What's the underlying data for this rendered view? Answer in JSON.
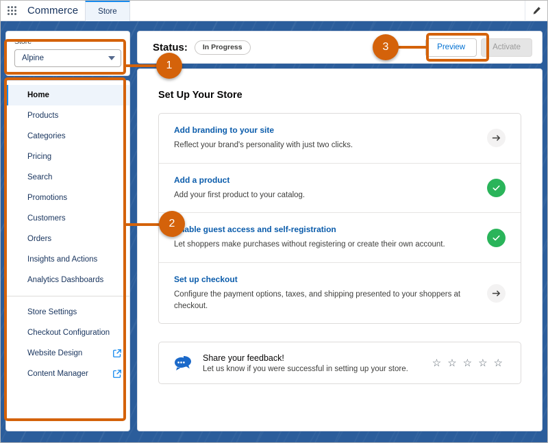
{
  "header": {
    "app_launcher_icon": "app-launcher-grid-icon",
    "app_name": "Commerce",
    "tab_label": "Store",
    "edit_icon": "pencil-icon"
  },
  "store_selector": {
    "label": "Store",
    "value": "Alpine",
    "caret_icon": "chevron-down-icon"
  },
  "sidebar": {
    "primary_items": [
      {
        "label": "Home",
        "active": true
      },
      {
        "label": "Products",
        "active": false
      },
      {
        "label": "Categories",
        "active": false
      },
      {
        "label": "Pricing",
        "active": false
      },
      {
        "label": "Search",
        "active": false
      },
      {
        "label": "Promotions",
        "active": false
      },
      {
        "label": "Customers",
        "active": false
      },
      {
        "label": "Orders",
        "active": false
      },
      {
        "label": "Insights and Actions",
        "active": false
      },
      {
        "label": "Analytics Dashboards",
        "active": false
      }
    ],
    "secondary_items": [
      {
        "label": "Store Settings",
        "external": false
      },
      {
        "label": "Checkout Configuration",
        "external": false
      },
      {
        "label": "Website Design",
        "external": true,
        "icon": "external-link-icon"
      },
      {
        "label": "Content Manager",
        "external": true,
        "icon": "external-link-icon"
      }
    ]
  },
  "status_bar": {
    "label": "Status:",
    "badge": "In Progress",
    "preview_button": "Preview",
    "activate_button": "Activate"
  },
  "main": {
    "title": "Set Up Your Store",
    "tasks": [
      {
        "title": "Add branding to your site",
        "description": "Reflect your brand's personality with just two clicks.",
        "state": "incomplete",
        "icon": "arrow-right-icon"
      },
      {
        "title": "Add a product",
        "description": "Add your first product to your catalog.",
        "state": "complete",
        "icon": "check-circle-icon"
      },
      {
        "title": "Enable guest access and self-registration",
        "description": "Let shoppers make purchases without registering or create their own account.",
        "state": "complete",
        "icon": "check-circle-icon"
      },
      {
        "title": "Set up checkout",
        "description": "Configure the payment options, taxes, and shipping presented to your shoppers at checkout.",
        "state": "incomplete",
        "icon": "arrow-right-icon"
      }
    ],
    "feedback": {
      "icon": "chat-bubbles-icon",
      "title": "Share your feedback!",
      "subtitle": "Let us know if you were successful in setting up your store.",
      "stars": [
        "☆",
        "☆",
        "☆",
        "☆",
        "☆"
      ]
    }
  },
  "annotations": {
    "badge_1": "1",
    "badge_2": "2",
    "badge_3": "3",
    "color": "#d4620a"
  }
}
